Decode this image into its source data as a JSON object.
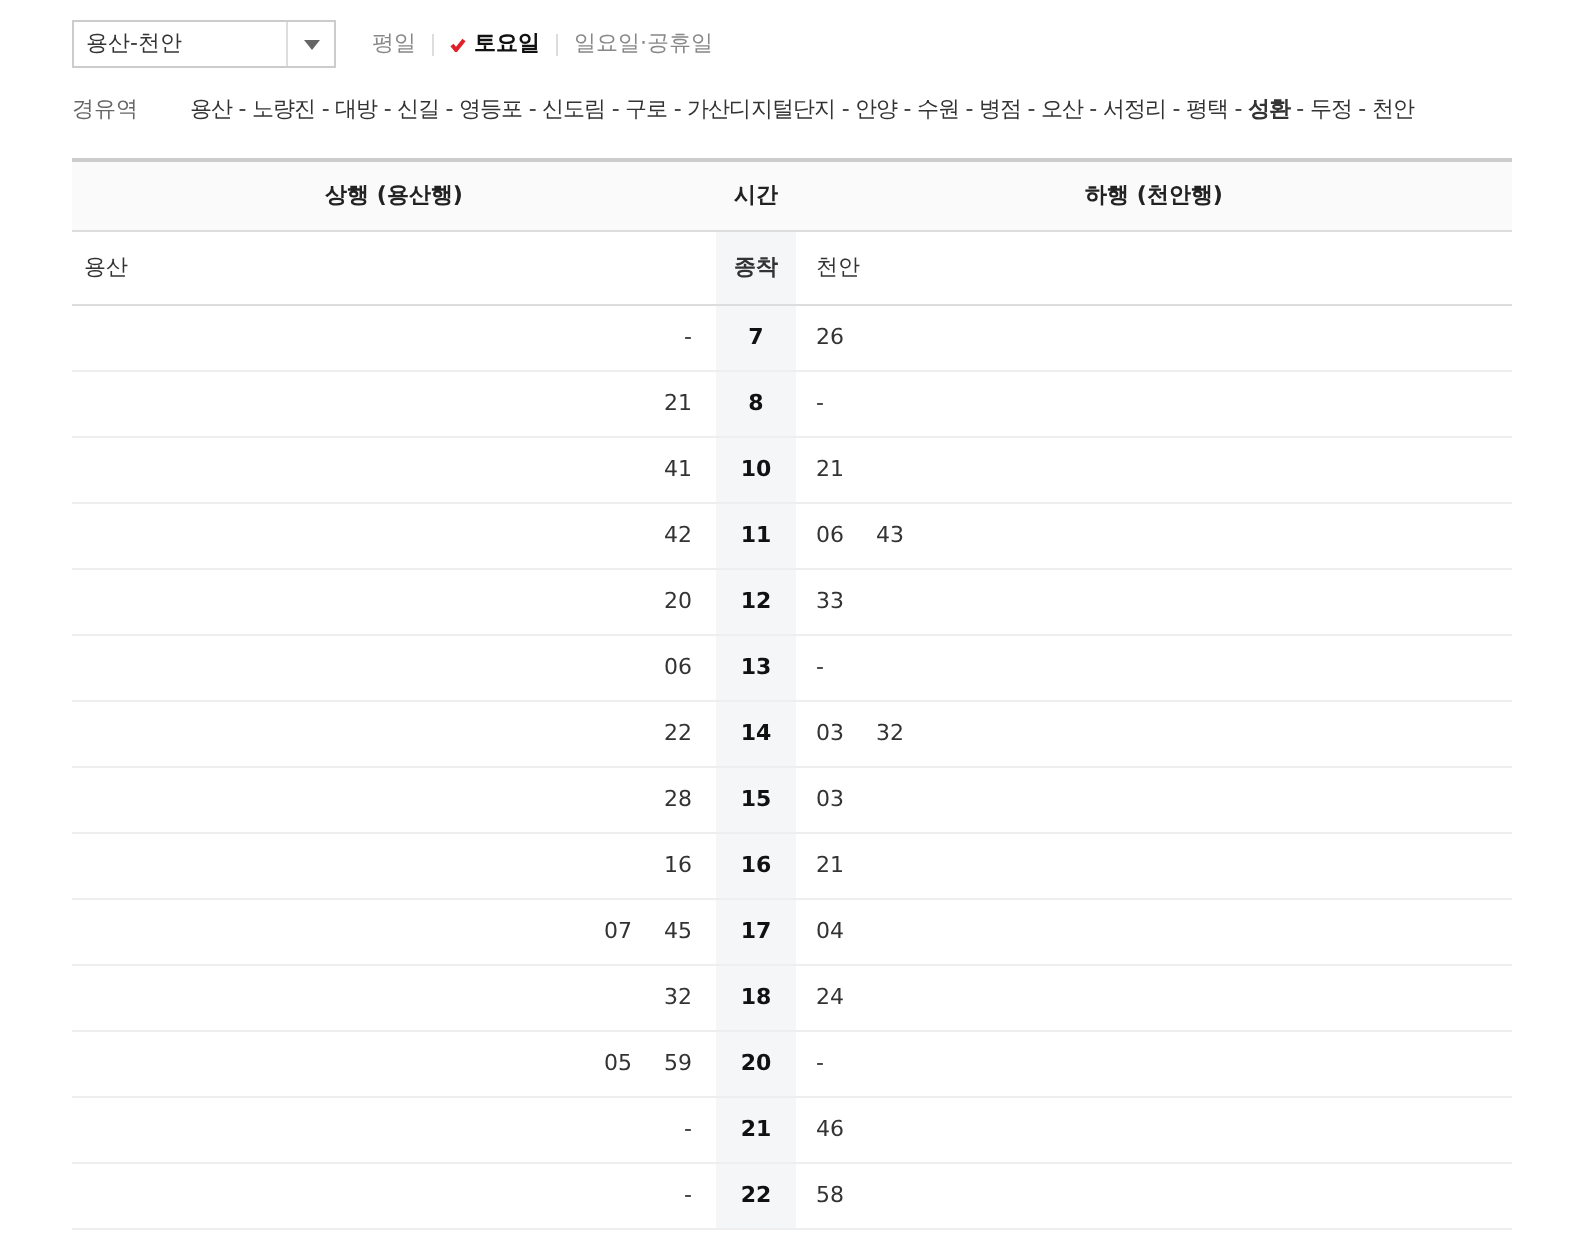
{
  "line_select": {
    "value": "용산-천안"
  },
  "day_tabs": [
    {
      "label": "평일",
      "selected": false
    },
    {
      "label": "토요일",
      "selected": true
    },
    {
      "label": "일요일·공휴일",
      "selected": false
    }
  ],
  "route": {
    "label": "경유역",
    "stations": "용산 - 노량진 - 대방 - 신길 - 영등포 - 신도림 - 구로 - 가산디지털단지 - 안양 - 수원 - 병점 - 오산 - 서정리 - 평택 - **성환** - 두정 - 천안"
  },
  "table": {
    "columns": [
      "상행 (용산행)",
      "시간",
      "하행 (천안행)"
    ],
    "subheader": {
      "up": "용산",
      "hour": "종착",
      "down": "천안"
    },
    "rows": [
      {
        "up": [
          "-"
        ],
        "hour": "7",
        "down": [
          "26"
        ]
      },
      {
        "up": [
          "21"
        ],
        "hour": "8",
        "down": [
          "-"
        ]
      },
      {
        "up": [
          "41"
        ],
        "hour": "10",
        "down": [
          "21"
        ]
      },
      {
        "up": [
          "42"
        ],
        "hour": "11",
        "down": [
          "06",
          "43"
        ]
      },
      {
        "up": [
          "20"
        ],
        "hour": "12",
        "down": [
          "33"
        ]
      },
      {
        "up": [
          "06"
        ],
        "hour": "13",
        "down": [
          "-"
        ]
      },
      {
        "up": [
          "22"
        ],
        "hour": "14",
        "down": [
          "03",
          "32"
        ]
      },
      {
        "up": [
          "28"
        ],
        "hour": "15",
        "down": [
          "03"
        ]
      },
      {
        "up": [
          "16"
        ],
        "hour": "16",
        "down": [
          "21"
        ]
      },
      {
        "up": [
          "07",
          "45"
        ],
        "hour": "17",
        "down": [
          "04"
        ]
      },
      {
        "up": [
          "32"
        ],
        "hour": "18",
        "down": [
          "24"
        ]
      },
      {
        "up": [
          "05",
          "59"
        ],
        "hour": "20",
        "down": [
          "-"
        ]
      },
      {
        "up": [
          "-"
        ],
        "hour": "21",
        "down": [
          "46"
        ]
      },
      {
        "up": [
          "-"
        ],
        "hour": "22",
        "down": [
          "58"
        ]
      }
    ]
  }
}
